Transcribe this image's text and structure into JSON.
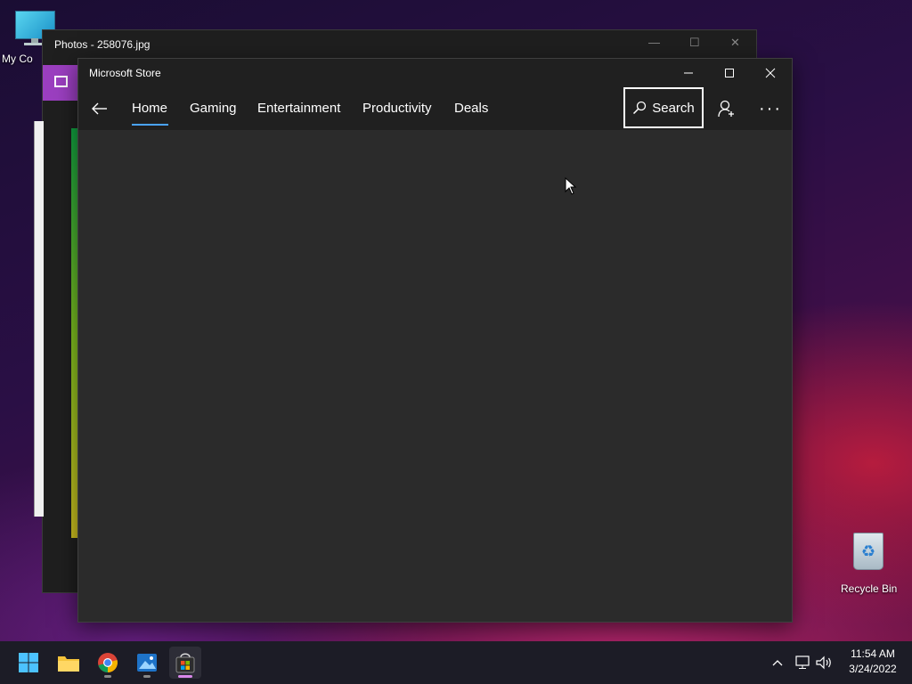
{
  "desktop": {
    "my_computer_label": "My Co",
    "recycle_bin_label": "Recycle Bin"
  },
  "photos_window": {
    "title": "Photos - 258076.jpg",
    "controls": {
      "minimize": "—",
      "maximize": "☐",
      "close": "✕"
    }
  },
  "store_window": {
    "title": "Microsoft Store",
    "controls": {
      "minimize": "—",
      "maximize": "☐",
      "close": "✕"
    },
    "nav": {
      "back_glyph": "←",
      "tabs": [
        "Home",
        "Gaming",
        "Entertainment",
        "Productivity",
        "Deals"
      ],
      "active_tab": "Home",
      "search_label": "Search",
      "more_glyph": "···"
    }
  },
  "taskbar": {
    "apps": [
      "start-button",
      "file-explorer",
      "chrome",
      "photos",
      "microsoft-store"
    ],
    "active_app": "microsoft-store",
    "tray_chevron": "^",
    "clock_time": "11:54 AM",
    "clock_date": "3/24/2022"
  },
  "colors": {
    "accent": "#4aa3ff",
    "store_bg": "#2b2b2b",
    "titlebar_bg": "#202020",
    "active_indicator": "#d987e9"
  }
}
